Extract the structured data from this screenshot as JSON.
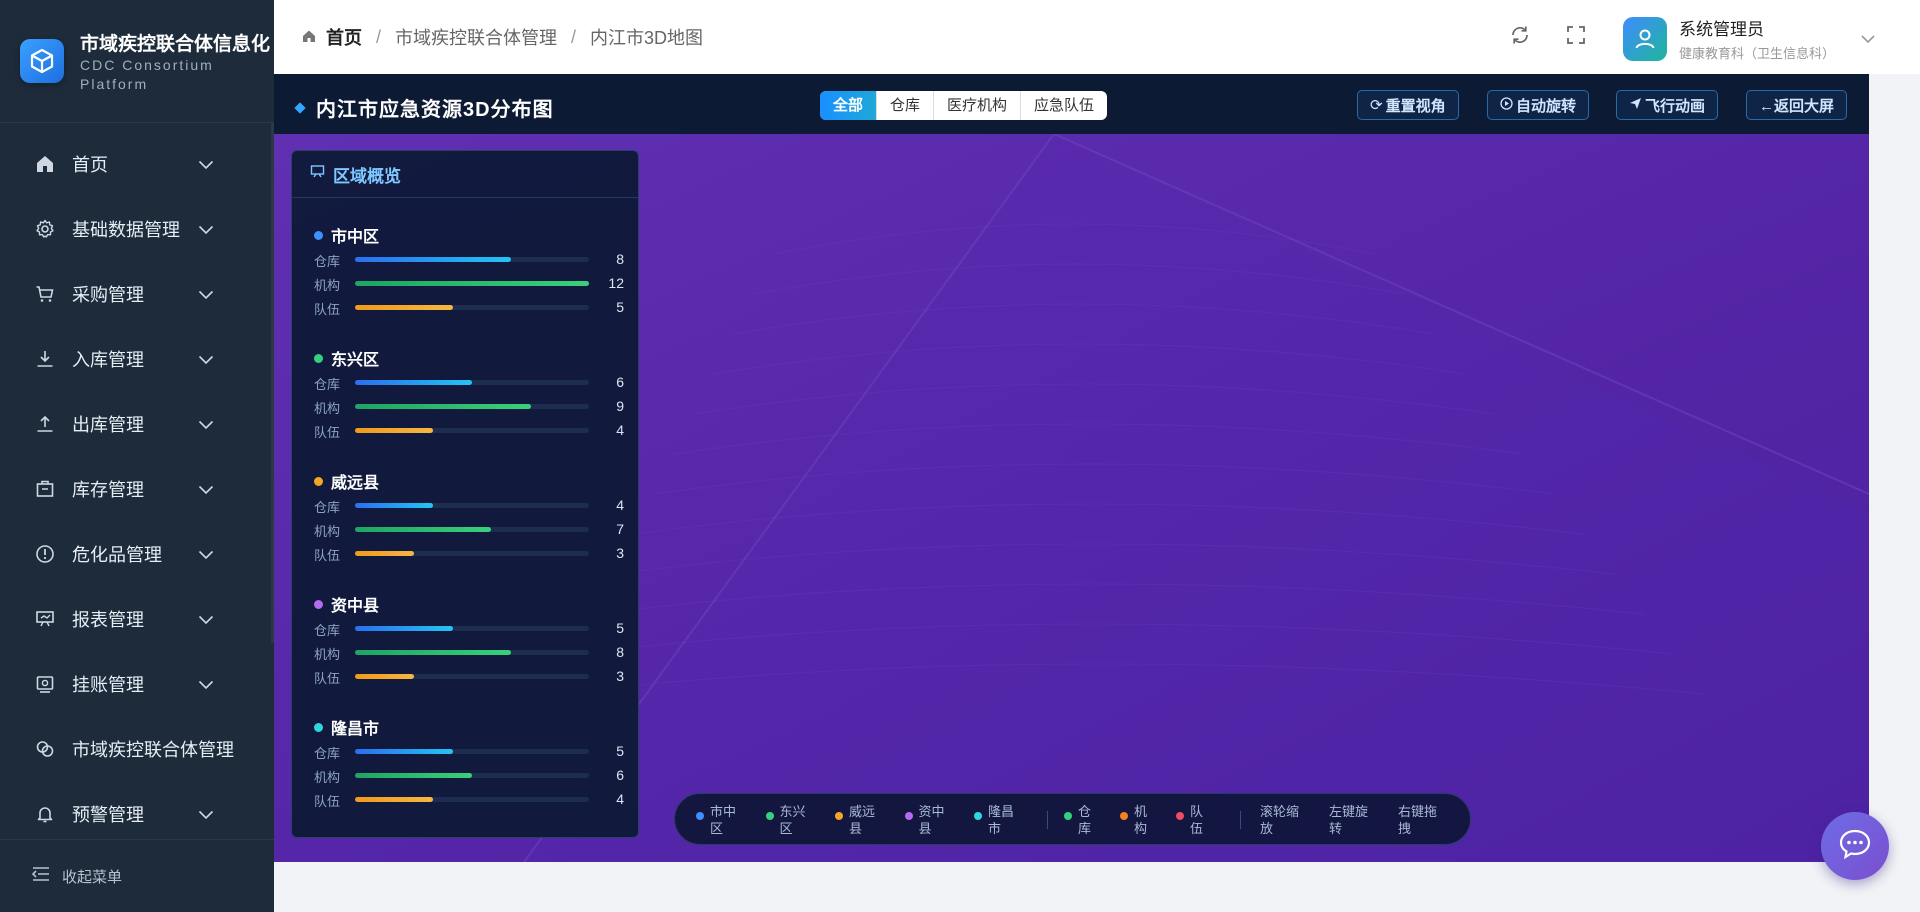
{
  "brand": {
    "title": "市域疾控联合体信息化",
    "subtitle_line1": "CDC Consortium",
    "subtitle_line2": "Platform",
    "logo_icon": "cube-icon"
  },
  "sidebar": {
    "items": [
      {
        "label": "首页",
        "icon": "home-icon",
        "expandable": true
      },
      {
        "label": "基础数据管理",
        "icon": "gear-icon",
        "expandable": true
      },
      {
        "label": "采购管理",
        "icon": "cart-icon",
        "expandable": true
      },
      {
        "label": "入库管理",
        "icon": "download-icon",
        "expandable": true
      },
      {
        "label": "出库管理",
        "icon": "upload-icon",
        "expandable": true
      },
      {
        "label": "库存管理",
        "icon": "box-icon",
        "expandable": true
      },
      {
        "label": "危化品管理",
        "icon": "alert-icon",
        "expandable": true
      },
      {
        "label": "报表管理",
        "icon": "board-icon",
        "expandable": true
      },
      {
        "label": "挂账管理",
        "icon": "ledger-icon",
        "expandable": true
      },
      {
        "label": "市域疾控联合体管理",
        "icon": "link-icon",
        "expandable": false
      },
      {
        "label": "预警管理",
        "icon": "bell-icon",
        "expandable": true
      }
    ],
    "collapse_label": "收起菜单"
  },
  "header": {
    "breadcrumb": [
      "首页",
      "市域疾控联合体管理",
      "内江市3D地图"
    ],
    "user_name": "系统管理员",
    "user_dept": "健康教育科（卫生信息科）"
  },
  "map": {
    "title": "内江市应急资源3D分布图",
    "filters": [
      {
        "label": "全部",
        "active": true
      },
      {
        "label": "仓库",
        "active": false
      },
      {
        "label": "医疗机构",
        "active": false
      },
      {
        "label": "应急队伍",
        "active": false
      }
    ],
    "actions": {
      "reset": "重置视角",
      "rotate": "自动旋转",
      "fly": "飞行动画",
      "back": "←返回大屏"
    },
    "background_color": "#5424a6"
  },
  "panel": {
    "title": "区域概览",
    "max_value": 12,
    "row_labels": {
      "warehouse": "仓库",
      "org": "机构",
      "team": "队伍"
    },
    "regions": [
      {
        "name": "市中区",
        "color": "#3f8fff",
        "warehouse": 8,
        "org": 12,
        "team": 5
      },
      {
        "name": "东兴区",
        "color": "#35d07f",
        "warehouse": 6,
        "org": 9,
        "team": 4
      },
      {
        "name": "威远县",
        "color": "#f5a623",
        "warehouse": 4,
        "org": 7,
        "team": 3
      },
      {
        "name": "资中县",
        "color": "#b26cf0",
        "warehouse": 5,
        "org": 8,
        "team": 3
      },
      {
        "name": "隆昌市",
        "color": "#2fd6e0",
        "warehouse": 5,
        "org": 6,
        "team": 4
      }
    ]
  },
  "legend": {
    "regions": [
      {
        "label": "市中区",
        "color": "#3f8fff"
      },
      {
        "label": "东兴区",
        "color": "#35d07f"
      },
      {
        "label": "威远县",
        "color": "#f5a623"
      },
      {
        "label": "资中县",
        "color": "#b26cf0"
      },
      {
        "label": "隆昌市",
        "color": "#2fd6e0"
      }
    ],
    "types": [
      {
        "label": "仓库",
        "color": "#35d07f"
      },
      {
        "label": "机构",
        "color": "#f5821f"
      },
      {
        "label": "队伍",
        "color": "#f04b5f"
      }
    ],
    "tips": [
      "滚轮缩放",
      "左键旋转",
      "右键拖拽"
    ]
  }
}
